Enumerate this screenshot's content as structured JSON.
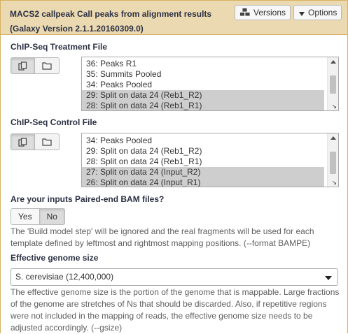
{
  "header": {
    "title_line1": "MACS2 callpeak Call peaks from alignment results",
    "title_line2": "(Galaxy Version 2.1.1.20160309.0)",
    "versions_label": "Versions",
    "options_label": "Options"
  },
  "treatment": {
    "label": "ChIP-Seq Treatment File",
    "options": [
      {
        "text": "36: Peaks R1",
        "selected": false
      },
      {
        "text": "35: Summits Pooled",
        "selected": false
      },
      {
        "text": "34: Peaks Pooled",
        "selected": false
      },
      {
        "text": "29: Split on data 24 (Reb1_R2)",
        "selected": true
      },
      {
        "text": "28: Split on data 24 (Reb1_R1)",
        "selected": true
      }
    ]
  },
  "control": {
    "label": "ChIP-Seq Control File",
    "options": [
      {
        "text": "34: Peaks Pooled",
        "selected": false
      },
      {
        "text": "29: Split on data 24 (Reb1_R2)",
        "selected": false
      },
      {
        "text": "28: Split on data 24 (Reb1_R1)",
        "selected": false
      },
      {
        "text": "27: Split on data 24 (Input_R2)",
        "selected": true
      },
      {
        "text": "26: Split on data 24 (Input_R1)",
        "selected": true
      }
    ]
  },
  "paired": {
    "label": "Are your inputs Paired-end BAM files?",
    "yes_label": "Yes",
    "no_label": "No",
    "selected": "No",
    "help": "The 'Build model step' will be ignored and the real fragments will be used for each template defined by leftmost and rightmost mapping positions. (--format BAMPE)"
  },
  "genome": {
    "label": "Effective genome size",
    "value": "S. cerevisiae (12,400,000)",
    "help": "The effective genome size is the portion of the genome that is mappable. Large fractions of the genome are stretches of Ns that should be discarded. Also, if repetitive regions were not included in the mapping of reads, the effective genome size needs to be adjusted accordingly. (--gsize)"
  },
  "icons": {
    "versions": "cubes-icon",
    "options": "caret-down-icon",
    "multi_select": "copy-icon",
    "collection": "folder-icon",
    "resize": "resize-grip-icon"
  },
  "colors": {
    "header_bg": "#ebd9b2",
    "header_border": "#d6b161",
    "selected_option_bg": "#cecece"
  }
}
